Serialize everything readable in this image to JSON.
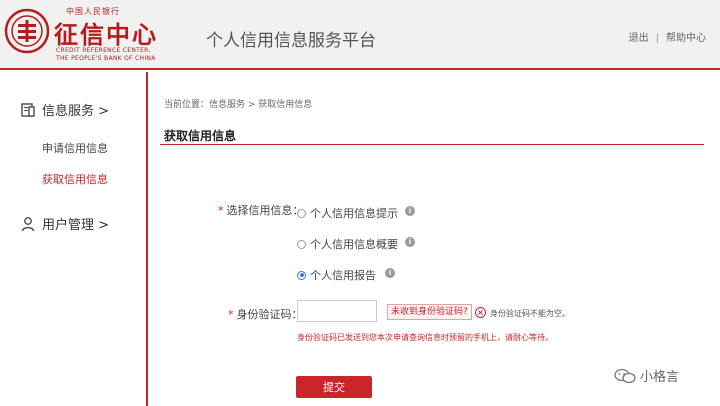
{
  "header": {
    "logo_top": "中国人民银行",
    "logo_main": "征信中心",
    "logo_en_line1": "CREDIT REFERENCE CENTER,",
    "logo_en_line2": "THE PEOPLE'S BANK OF CHINA",
    "platform_title": "个人信用信息服务平台",
    "logout": "退出",
    "separator": "|",
    "help": "帮助中心"
  },
  "sidebar": {
    "info_service": "信息服务 >",
    "apply_info": "申请信用信息",
    "get_info": "获取信用信息",
    "user_manage": "用户管理 >"
  },
  "main": {
    "breadcrumb": "当前位置：信息服务 > 获取信用信息",
    "section_title": "获取信用信息",
    "select_label": "选择信用信息：",
    "required_mark": "*",
    "options": [
      {
        "label": "个人信用信息提示",
        "checked": false
      },
      {
        "label": "个人信用信息概要",
        "checked": false
      },
      {
        "label": "个人信用报告",
        "checked": true
      }
    ],
    "code_label": "身份验证码：",
    "code_value": "",
    "not_received": "未收到身份验证码?",
    "error_text": "身份验证码不能为空。",
    "hint_text": "身份验证码已发送到您本次申请查询信息时预留的手机上，请耐心等待。",
    "submit": "提交"
  },
  "watermark": "小格言",
  "colors": {
    "brand_red": "#c9252a",
    "header_bg": "#f1f1f1",
    "radio_blue": "#3a7bd5"
  }
}
